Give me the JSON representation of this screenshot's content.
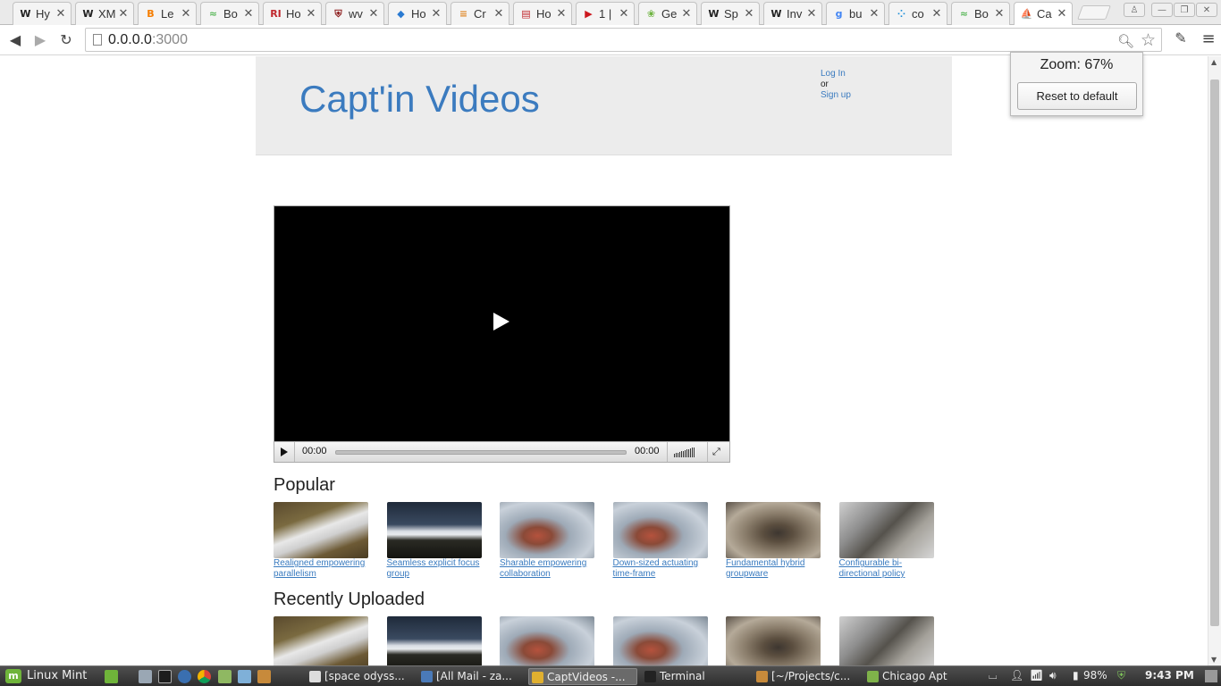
{
  "browser": {
    "tabs": [
      {
        "label": "Hy",
        "icon": "wikipedia-icon",
        "glyph": "W",
        "color": "#222222"
      },
      {
        "label": "XM",
        "icon": "wikipedia-icon",
        "glyph": "W",
        "color": "#222222"
      },
      {
        "label": "Le",
        "icon": "blogger-icon",
        "glyph": "B",
        "color": "#f57d00"
      },
      {
        "label": "Bo",
        "icon": "bootsnipp-icon",
        "glyph": "≈",
        "color": "#5cb85c"
      },
      {
        "label": "Ho",
        "icon": "ri-icon",
        "glyph": "RI",
        "color": "#c0272d"
      },
      {
        "label": "wv",
        "icon": "shield-icon",
        "glyph": "⛨",
        "color": "#8b1a1a"
      },
      {
        "label": "Ho",
        "icon": "diamond-icon",
        "glyph": "◆",
        "color": "#2a7ad1"
      },
      {
        "label": "Cr",
        "icon": "stackoverflow-icon",
        "glyph": "≡",
        "color": "#e08a2c"
      },
      {
        "label": "Ho",
        "icon": "book-icon",
        "glyph": "▤",
        "color": "#c0272d"
      },
      {
        "label": "1 |",
        "icon": "youtube-icon",
        "glyph": "▶",
        "color": "#cc181e"
      },
      {
        "label": "Ge",
        "icon": "spring-icon",
        "glyph": "❀",
        "color": "#6db33f"
      },
      {
        "label": "Sp",
        "icon": "wikipedia-icon",
        "glyph": "W",
        "color": "#222222"
      },
      {
        "label": "Inv",
        "icon": "wikipedia-icon",
        "glyph": "W",
        "color": "#222222"
      },
      {
        "label": "bu",
        "icon": "google-icon",
        "glyph": "g",
        "color": "#4285f4"
      },
      {
        "label": "co",
        "icon": "dots-icon",
        "glyph": "⁘",
        "color": "#1a8dd8"
      },
      {
        "label": "Bo",
        "icon": "bootsnipp-icon",
        "glyph": "≈",
        "color": "#5cb85c"
      },
      {
        "label": "Ca",
        "icon": "captain-icon",
        "glyph": "⛵",
        "color": "#b8452a"
      }
    ],
    "url_host": "0.0.0.0",
    "url_port": ":3000",
    "zoom_label": "Zoom: 67%",
    "zoom_reset": "Reset to default"
  },
  "site": {
    "brand": "Capt'in Videos",
    "login": "Log In",
    "or": "or",
    "signup": "Sign up",
    "player": {
      "current_time": "00:00",
      "duration": "00:00"
    },
    "popular_title": "Popular",
    "recent_title": "Recently Uploaded",
    "popular": [
      {
        "caption": "Realigned empowering parallelism",
        "thumb": "t1"
      },
      {
        "caption": "Seamless explicit focus group",
        "thumb": "t2"
      },
      {
        "caption": "Sharable empowering collaboration",
        "thumb": "t3"
      },
      {
        "caption": "Down-sized actuating time-frame",
        "thumb": "t3"
      },
      {
        "caption": "Fundamental hybrid groupware",
        "thumb": "t4"
      },
      {
        "caption": "Configurable bi-directional policy",
        "thumb": "t5"
      }
    ],
    "recent": [
      {
        "thumb": "t1"
      },
      {
        "thumb": "t2"
      },
      {
        "thumb": "t3"
      },
      {
        "thumb": "t3"
      },
      {
        "thumb": "t4"
      },
      {
        "thumb": "t5"
      }
    ]
  },
  "taskbar": {
    "menu_label": "Linux Mint",
    "tasks": [
      {
        "label": "[space odyss...",
        "icon": "media-player-icon",
        "color": "#dddddd"
      },
      {
        "label": "[All Mail - za...",
        "icon": "thunderbird-icon",
        "color": "#4a7ab8"
      },
      {
        "label": "CaptVideos -...",
        "icon": "chrome-icon",
        "color": "#e0b030",
        "active": true
      },
      {
        "label": "Terminal",
        "icon": "terminal-icon",
        "color": "#222222"
      },
      {
        "label": "[~/Projects/c...",
        "icon": "editor-icon",
        "color": "#c78a3b"
      },
      {
        "label": "Chicago Apt",
        "icon": "folder-icon",
        "color": "#7fb24a"
      }
    ],
    "battery": "98%",
    "clock": "9:43 PM"
  }
}
